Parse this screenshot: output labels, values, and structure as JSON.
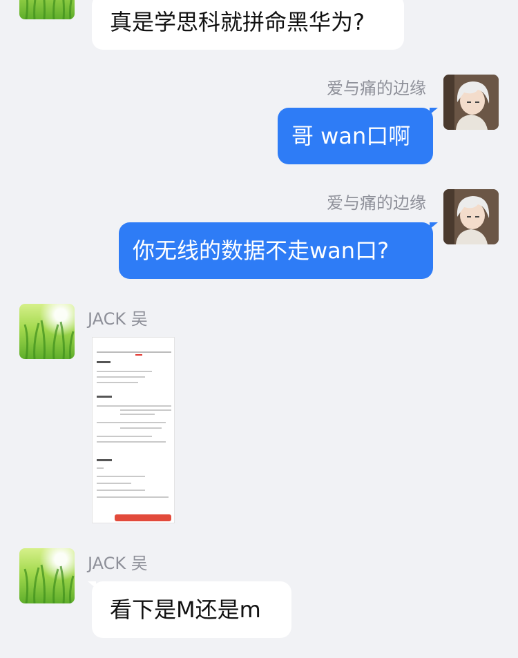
{
  "messages": [
    {
      "sender": "",
      "text": "真是学思科就拼命黑华为?"
    },
    {
      "sender": "爱与痛的边缘",
      "text": "哥 wan口啊"
    },
    {
      "sender": "爱与痛的边缘",
      "text": "你无线的数据不走wan口?"
    },
    {
      "sender": "JACK 吴",
      "text": ""
    },
    {
      "sender": "JACK 吴",
      "text": "看下是M还是m"
    }
  ],
  "colors": {
    "background": "#f1f2f5",
    "incoming_bubble": "#ffffff",
    "outgoing_bubble": "#2e7cf6",
    "sender_name": "#8e9099"
  },
  "icons": {
    "incoming_avatar": "grass-avatar-icon",
    "outgoing_avatar": "anime-character-avatar-icon",
    "image_message": "screenshot-image"
  }
}
